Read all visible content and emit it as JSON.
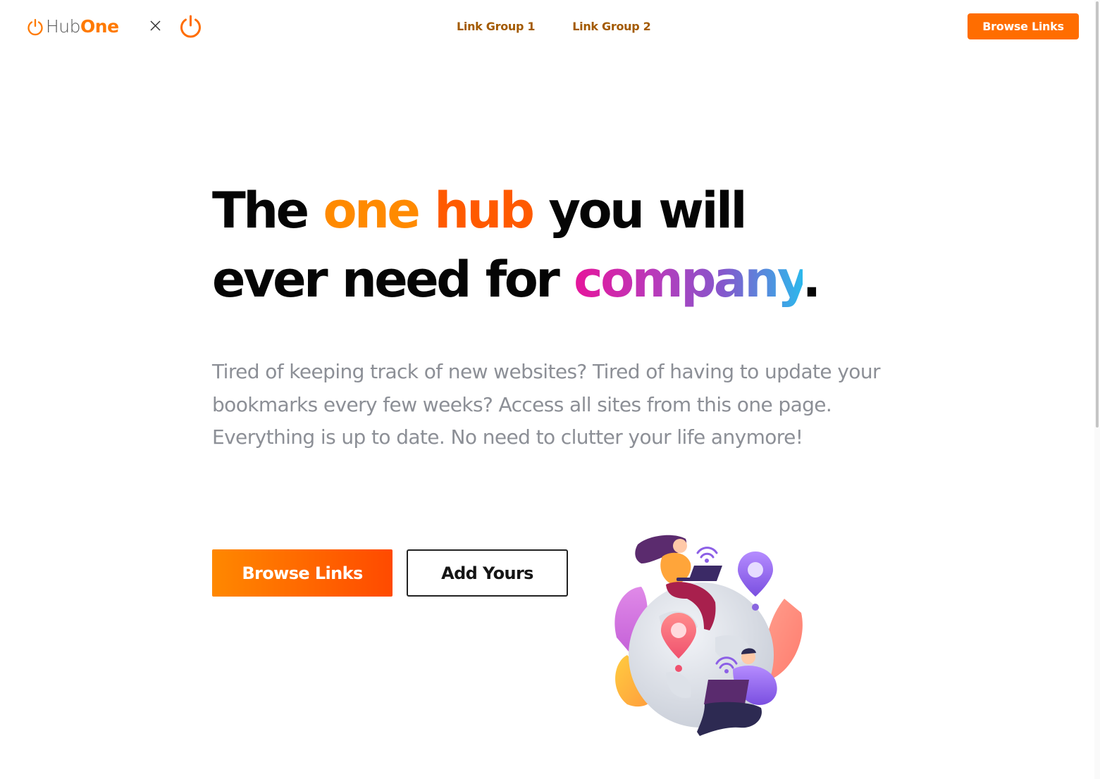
{
  "header": {
    "brand_hub": "Hub",
    "brand_one": "One",
    "nav": [
      {
        "label": "Link Group 1"
      },
      {
        "label": "Link Group 2"
      }
    ],
    "cta_label": "Browse Links"
  },
  "hero": {
    "headline": {
      "w1": "The ",
      "w2": "one ",
      "w3": "hub",
      "w4": " you will",
      "w5": "ever need for ",
      "w6": "company",
      "w7": "."
    },
    "lead": "Tired of keeping track of new websites? Tired of having to update your bookmarks every few weeks? Access all sites from this one page. Everything is up to date. No need to clutter your life anymore!",
    "primary_button": "Browse Links",
    "secondary_button": "Add Yours"
  },
  "icons": {
    "logo": "power-icon",
    "collab": "close-icon",
    "partner_logo": "power-icon",
    "illustration": "globe-people-illustration"
  },
  "colors": {
    "accent": "#ff6d00",
    "accent_light": "#ff8a00",
    "nav_text": "#a35a00",
    "headline": "#050505",
    "lead_text": "#8c8f96",
    "gradient_pink": "#e6159b",
    "gradient_purple": "#8557cc",
    "gradient_blue": "#2cb8ec"
  }
}
